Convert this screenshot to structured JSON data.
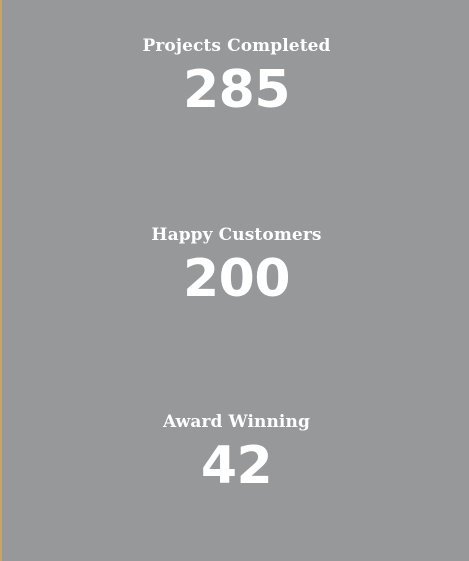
{
  "stats": [
    {
      "label": "Projects Completed",
      "value": "285"
    },
    {
      "label": "Happy Customers",
      "value": "200"
    },
    {
      "label": "Award Winning",
      "value": "42"
    }
  ],
  "colors": {
    "background": "#97989a",
    "text": "#ffffff",
    "left_border": "#c9a46a"
  }
}
